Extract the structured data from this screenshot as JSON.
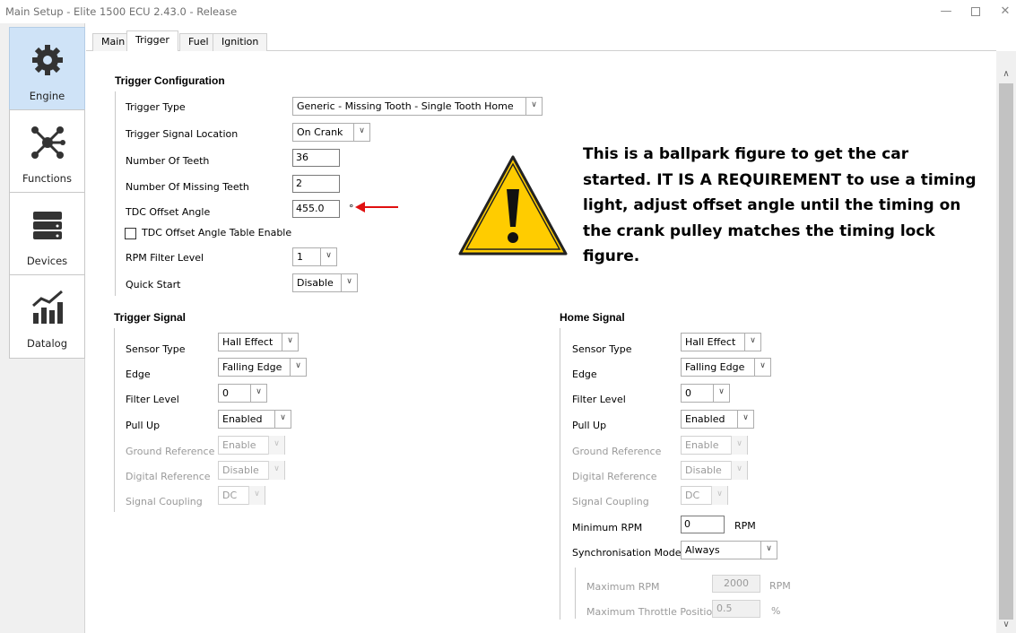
{
  "window": {
    "title": "Main Setup - Elite 1500 ECU 2.43.0 - Release"
  },
  "nav": [
    {
      "label": "Engine",
      "icon": "gear-icon"
    },
    {
      "label": "Functions",
      "icon": "network-icon"
    },
    {
      "label": "Devices",
      "icon": "server-icon"
    },
    {
      "label": "Datalog",
      "icon": "chart-icon"
    }
  ],
  "tabs": [
    "Main",
    "Trigger",
    "Fuel",
    "Ignition"
  ],
  "trigger_config": {
    "title": "Trigger Configuration",
    "trigger_type_label": "Trigger Type",
    "trigger_type_value": "Generic - Missing Tooth - Single Tooth Home",
    "signal_location_label": "Trigger Signal Location",
    "signal_location_value": "On Crank",
    "num_teeth_label": "Number Of Teeth",
    "num_teeth_value": "36",
    "missing_teeth_label": "Number Of Missing Teeth",
    "missing_teeth_value": "2",
    "tdc_label": "TDC Offset Angle",
    "tdc_value": "455.0",
    "tdc_unit": "°",
    "tdc_table_label": "TDC Offset Angle Table Enable",
    "rpm_filter_label": "RPM Filter Level",
    "rpm_filter_value": "1",
    "quick_start_label": "Quick Start",
    "quick_start_value": "Disable"
  },
  "trigger_signal": {
    "title": "Trigger Signal",
    "sensor_type_label": "Sensor Type",
    "sensor_type_value": "Hall Effect",
    "edge_label": "Edge",
    "edge_value": "Falling Edge",
    "filter_label": "Filter Level",
    "filter_value": "0",
    "pullup_label": "Pull Up",
    "pullup_value": "Enabled",
    "ground_label": "Ground Reference",
    "ground_value": "Enable",
    "digital_label": "Digital Reference",
    "digital_value": "Disable",
    "coupling_label": "Signal Coupling",
    "coupling_value": "DC"
  },
  "home_signal": {
    "title": "Home Signal",
    "sensor_type_label": "Sensor Type",
    "sensor_type_value": "Hall Effect",
    "edge_label": "Edge",
    "edge_value": "Falling Edge",
    "filter_label": "Filter Level",
    "filter_value": "0",
    "pullup_label": "Pull Up",
    "pullup_value": "Enabled",
    "ground_label": "Ground Reference",
    "ground_value": "Enable",
    "digital_label": "Digital Reference",
    "digital_value": "Disable",
    "coupling_label": "Signal Coupling",
    "coupling_value": "DC",
    "min_rpm_label": "Minimum RPM",
    "min_rpm_value": "0",
    "min_rpm_unit": "RPM",
    "sync_label": "Synchronisation Mode",
    "sync_value": "Always",
    "max_rpm_label": "Maximum RPM",
    "max_rpm_value": "2000",
    "max_rpm_unit": "RPM",
    "max_tp_label": "Maximum Throttle Position",
    "max_tp_value": "0.5",
    "max_tp_unit": "%"
  },
  "annotation": {
    "note": "This is a ballpark figure to get the car started. IT IS A REQUIREMENT to use a timing light, adjust offset angle until the timing on the crank pulley matches the timing lock figure.",
    "warning_color": "#ffcc00",
    "arrow_color": "#e01010"
  }
}
